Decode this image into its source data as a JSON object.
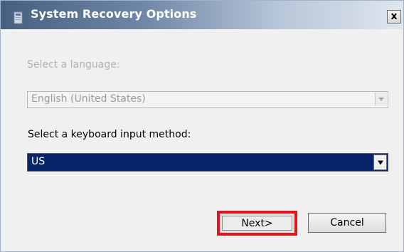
{
  "window": {
    "title": "System Recovery Options",
    "close_label": "x"
  },
  "language": {
    "label": "Select a language:",
    "value": "English (United States)",
    "enabled": false
  },
  "keyboard": {
    "label": "Select a keyboard input method:",
    "value": "US"
  },
  "buttons": {
    "next_label": "Next>",
    "cancel_label": "Cancel"
  },
  "colors": {
    "selection": "#0a246a",
    "highlight_box": "#e4141f"
  },
  "icons": {
    "title": "recovery-app-icon",
    "dropdown": "chevron-down-icon"
  }
}
